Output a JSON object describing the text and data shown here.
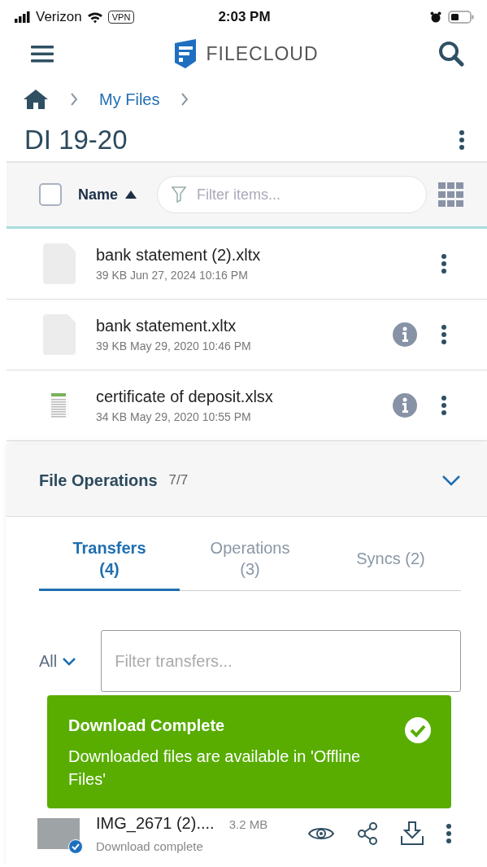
{
  "status_bar": {
    "carrier": "Verizon",
    "vpn": "VPN",
    "time": "2:03 PM"
  },
  "app_bar": {
    "logo_text": "FILECLOUD"
  },
  "breadcrumb": [
    {
      "label": "My Files"
    }
  ],
  "folder_title": "DI 19-20",
  "list_toolbar": {
    "select_all_checked": false,
    "sort_label": "Name",
    "sort_ascending": true,
    "filter_placeholder": "Filter items..."
  },
  "files": [
    {
      "name": "bank statement (2).xltx",
      "meta": "39 KB Jun 27, 2024 10:16 PM",
      "kind": "blank",
      "info": false
    },
    {
      "name": "bank statement.xltx",
      "meta": "39 KB May 29, 2020 10:46 PM",
      "kind": "blank",
      "info": true
    },
    {
      "name": "certificate of deposit.xlsx",
      "meta": "34 KB May 29, 2020 10:55 PM",
      "kind": "spreadsheet",
      "info": true
    }
  ],
  "file_operations": {
    "title": "File Operations",
    "count": "7/7",
    "expanded": true,
    "tabs": [
      {
        "label": "Transfers",
        "count": "(4)",
        "selected": true
      },
      {
        "label": "Operations",
        "count": "(3)",
        "selected": false
      },
      {
        "label": "Syncs",
        "count": "(2)",
        "selected": false
      }
    ],
    "type_filter": "All",
    "filter_placeholder": "Filter transfers...",
    "transfers": [
      {
        "name": "IMG_2671 (2)....",
        "size": "3.2 MB",
        "status": "Download complete",
        "done": true
      }
    ]
  },
  "toast": {
    "title": "Download Complete",
    "message": "Downloaded files are available in 'Offline Files'"
  }
}
